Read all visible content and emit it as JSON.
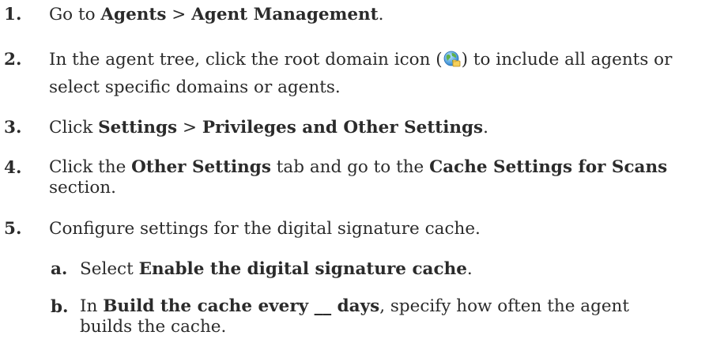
{
  "steps": [
    {
      "num": "1.",
      "t1": "Go to ",
      "b1": "Agents",
      "t2": " > ",
      "b2": "Agent Management",
      "t3": "."
    },
    {
      "num": "2.",
      "line1_pre": "In the agent tree, click the root domain icon (",
      "line1_post": ") to include all agents or",
      "line2": "select specific domains or agents.",
      "icon": "root-domain-globe-icon"
    },
    {
      "num": "3.",
      "t1": "Click ",
      "b1": "Settings",
      "t2": " > ",
      "b2": "Privileges and Other Settings",
      "t3": "."
    },
    {
      "num": "4.",
      "t1": "Click the ",
      "b1": "Other Settings",
      "t2": " tab and go to the ",
      "b2": "Cache Settings for Scans",
      "line2": "section."
    },
    {
      "num": "5.",
      "text": "Configure settings for the digital signature cache."
    }
  ],
  "substeps": [
    {
      "num": "a.",
      "t1": "Select ",
      "b1": "Enable the digital signature cache",
      "t2": "."
    },
    {
      "num": "b.",
      "t1": "In ",
      "b1": "Build the cache every __ days",
      "t2": ", specify how often the agent",
      "line2": "builds the cache."
    }
  ]
}
